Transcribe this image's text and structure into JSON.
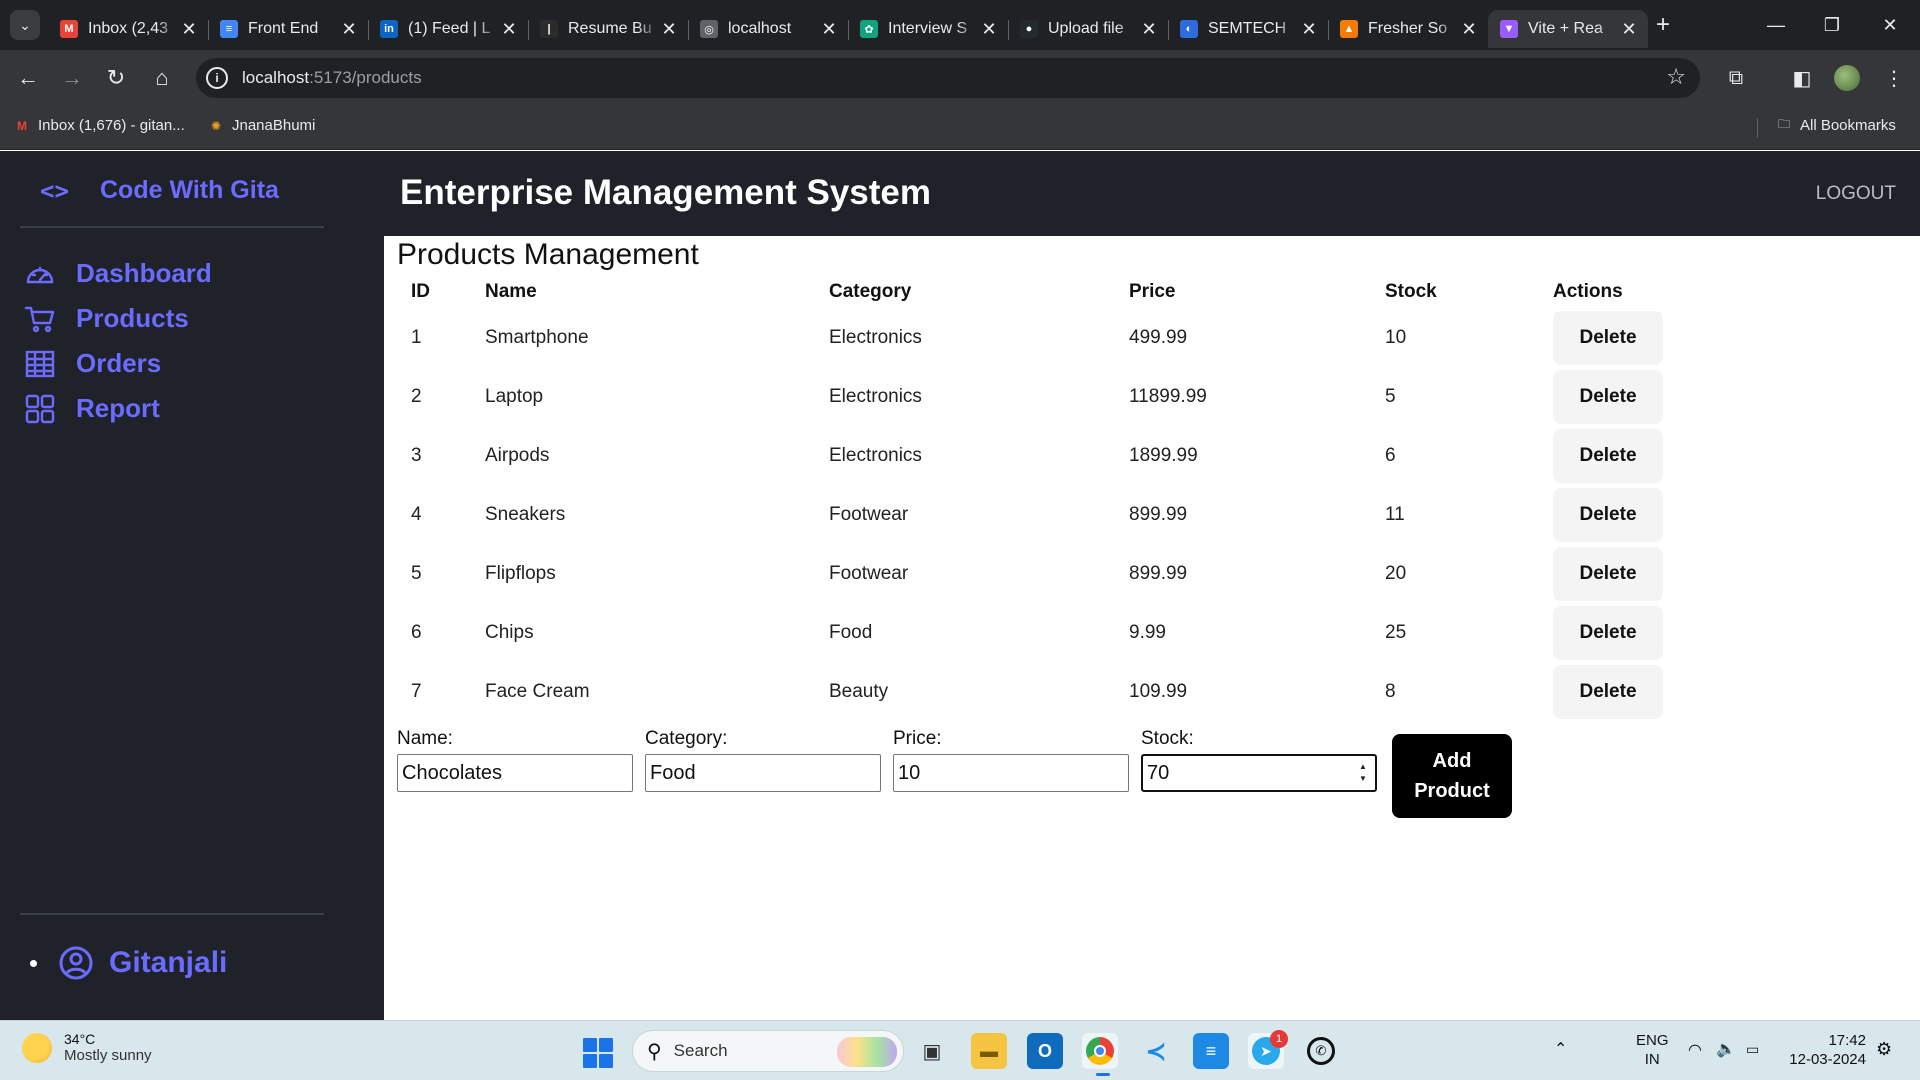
{
  "browser": {
    "tabs": [
      {
        "title": "Inbox (2,43",
        "favicon": "gmail-icon",
        "color": "#ea4335",
        "active": false
      },
      {
        "title": "Front End",
        "favicon": "docs-icon",
        "color": "#4285f4",
        "active": false
      },
      {
        "title": "(1) Feed | L",
        "favicon": "linkedin-icon",
        "color": "#0a66c2",
        "active": false
      },
      {
        "title": "Resume Bu",
        "favicon": "resume-icon",
        "color": "#2b2b2b",
        "active": false
      },
      {
        "title": "localhost",
        "favicon": "globe-icon",
        "color": "#5f6368",
        "active": false
      },
      {
        "title": "Interview S",
        "favicon": "chatgpt-icon",
        "color": "#10a37f",
        "active": false
      },
      {
        "title": "Upload file",
        "favicon": "github-icon",
        "color": "#24292f",
        "active": false
      },
      {
        "title": "SEMTECH",
        "favicon": "semtech-icon",
        "color": "#2d6cdf",
        "active": false
      },
      {
        "title": "Fresher So",
        "favicon": "fresher-icon",
        "color": "#f57c00",
        "active": false
      },
      {
        "title": "Vite + Rea",
        "favicon": "vite-icon",
        "color": "#9b5cff",
        "active": true
      }
    ],
    "url_host": "localhost",
    "url_path": ":5173/products",
    "bookmarks": [
      {
        "label": "Inbox (1,676) - gitan...",
        "icon": "gmail-icon"
      },
      {
        "label": "JnanaBhumi",
        "icon": "sun-icon"
      }
    ],
    "all_bookmarks": "All Bookmarks"
  },
  "app": {
    "brand": "Code With Gita",
    "title": "Enterprise Management System",
    "logout": "LOGOUT",
    "nav": [
      {
        "label": "Dashboard",
        "icon": "speedometer-icon"
      },
      {
        "label": "Products",
        "icon": "cart-icon"
      },
      {
        "label": "Orders",
        "icon": "table-icon"
      },
      {
        "label": "Report",
        "icon": "grid-icon"
      }
    ],
    "user": "Gitanjali",
    "accent": "#6b6bff"
  },
  "products": {
    "heading": "Products Management",
    "columns": [
      "ID",
      "Name",
      "Category",
      "Price",
      "Stock",
      "Actions"
    ],
    "rows": [
      {
        "id": "1",
        "name": "Smartphone",
        "category": "Electronics",
        "price": "499.99",
        "stock": "10"
      },
      {
        "id": "2",
        "name": "Laptop",
        "category": "Electronics",
        "price": "11899.99",
        "stock": "5"
      },
      {
        "id": "3",
        "name": "Airpods",
        "category": "Electronics",
        "price": "1899.99",
        "stock": "6"
      },
      {
        "id": "4",
        "name": "Sneakers",
        "category": "Footwear",
        "price": "899.99",
        "stock": "11"
      },
      {
        "id": "5",
        "name": "Flipflops",
        "category": "Footwear",
        "price": "899.99",
        "stock": "20"
      },
      {
        "id": "6",
        "name": "Chips",
        "category": "Food",
        "price": "9.99",
        "stock": "25"
      },
      {
        "id": "7",
        "name": "Face Cream",
        "category": "Beauty",
        "price": "109.99",
        "stock": "8"
      }
    ],
    "delete_label": "Delete",
    "form": {
      "name_label": "Name:",
      "name_value": "Chocolates",
      "category_label": "Category:",
      "category_value": "Food",
      "price_label": "Price:",
      "price_value": "10",
      "stock_label": "Stock:",
      "stock_value": "70",
      "add_label_1": "Add",
      "add_label_2": "Product"
    }
  },
  "taskbar": {
    "temperature": "34°C",
    "weather": "Mostly sunny",
    "search": "Search",
    "lang_1": "ENG",
    "lang_2": "IN",
    "time": "17:42",
    "date": "12-03-2024",
    "telegram_badge": "1"
  }
}
